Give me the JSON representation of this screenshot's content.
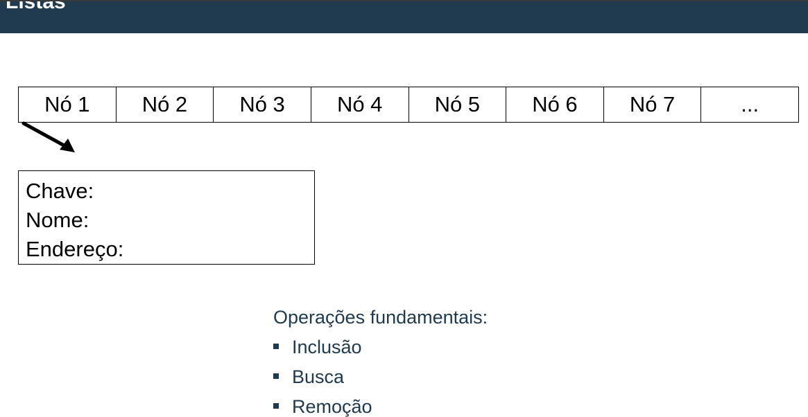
{
  "header": {
    "title": "Listas",
    "background_color": "#203b50"
  },
  "nodes": [
    "Nó 1",
    "Nó 2",
    "Nó 3",
    "Nó 4",
    "Nó 5",
    "Nó 6",
    "Nó 7",
    "..."
  ],
  "record": {
    "fields": [
      "Chave:",
      "Nome:",
      "Endereço:"
    ]
  },
  "operations": {
    "heading": "Operações fundamentais:",
    "items": [
      "Inclusão",
      "Busca",
      "Remoção"
    ],
    "text_color": "#203b50"
  }
}
